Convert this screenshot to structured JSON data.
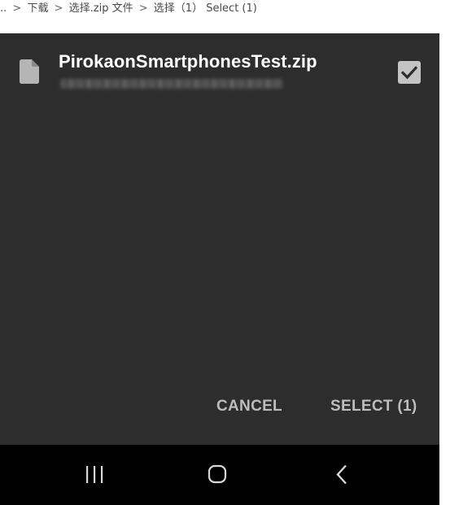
{
  "breadcrumb": {
    "items": [
      "..",
      "下载",
      "选择.zip 文件",
      "选择（1） Select (1)"
    ],
    "separator": ">"
  },
  "dialog": {
    "file": {
      "icon": "file-icon",
      "name": "PirokaonSmartphonesTest.zip",
      "checked": true
    },
    "actions": {
      "cancel_label": "CANCEL",
      "select_label": "SELECT (1)"
    }
  },
  "navbar": {
    "recents_icon": "recents-icon",
    "home_icon": "home-icon",
    "back_icon": "back-icon"
  },
  "colors": {
    "dialog_bg": "#2d2d2d",
    "text_primary": "#ffffff",
    "button_text": "#bdbdbd",
    "navbar_bg": "#000000",
    "checkbox_bg": "#c4c4c4"
  }
}
